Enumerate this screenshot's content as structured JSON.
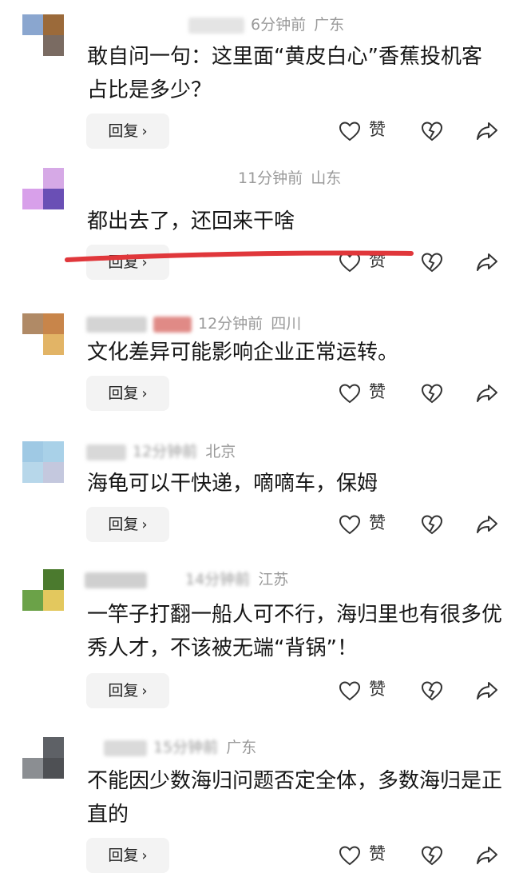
{
  "comments": [
    {
      "time": "6分钟前",
      "region": "广东",
      "text": "敢自问一句：这里面“黄皮白心”香蕉投机客占比是多少？",
      "reply_label": "回复",
      "like_label": "赞"
    },
    {
      "time": "11分钟前",
      "region": "山东",
      "text": "都出去了，还回来干啥",
      "reply_label": "回复",
      "like_label": "赞"
    },
    {
      "time": "12分钟前",
      "region": "四川",
      "text": "文化差异可能影响企业正常运转。",
      "reply_label": "回复",
      "like_label": "赞"
    },
    {
      "time": "12分钟前",
      "region": "北京",
      "text": "海龟可以干快递，嘀嘀车，保姆",
      "reply_label": "回复",
      "like_label": "赞"
    },
    {
      "time": "14分钟前",
      "region": "江苏",
      "text": "一竿子打翻一船人可不行，海归里也有很多优秀人才，不该被无端“背锅”！",
      "reply_label": "回复",
      "like_label": "赞"
    },
    {
      "time": "15分钟前",
      "region": "广东",
      "text": "不能因少数海归问题否定全体，多数海归是正直的",
      "reply_label": "回复",
      "like_label": "赞"
    }
  ],
  "icons": {
    "chevron": "chevron-right-icon",
    "like": "heart-icon",
    "dislike": "broken-heart-icon",
    "share": "share-icon"
  },
  "colors": {
    "annotation_line": "#e0373b",
    "meta_gray": "#9a9a9a",
    "reply_bg": "#f3f3f3"
  }
}
